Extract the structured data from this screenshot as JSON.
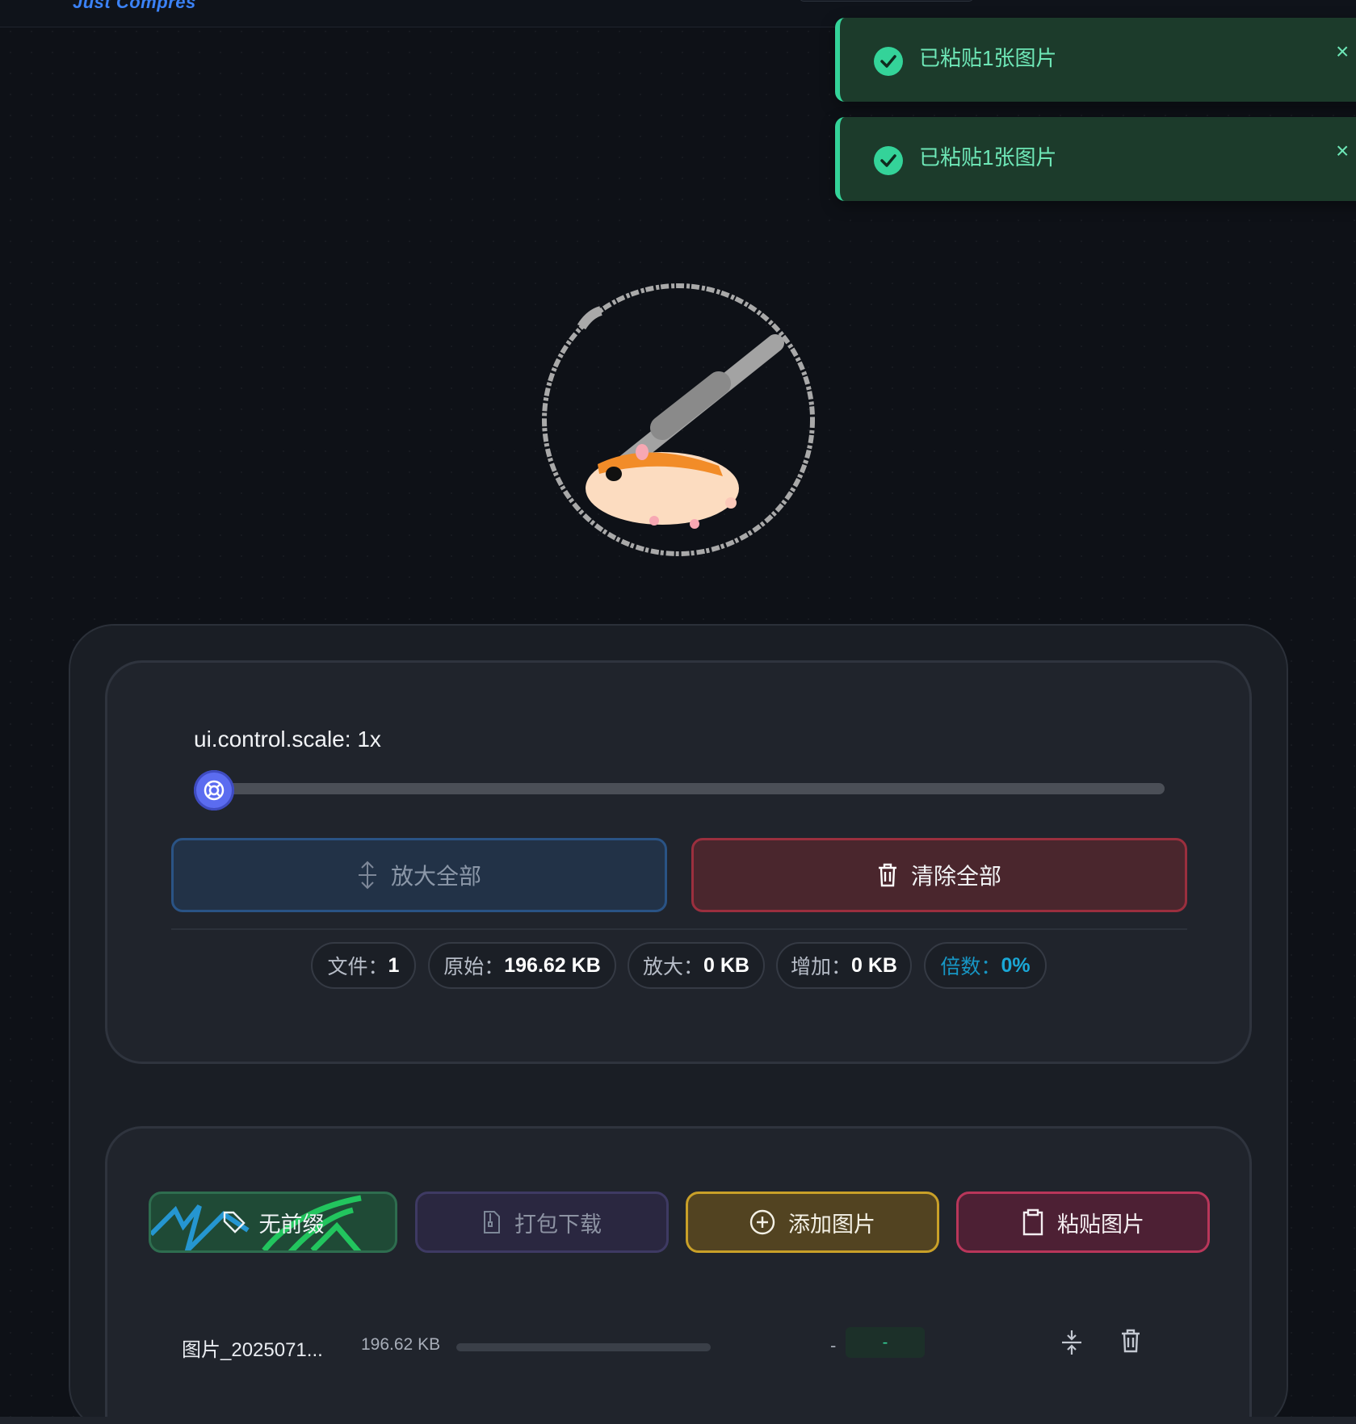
{
  "header": {
    "brand": "Just Compres"
  },
  "toasts": [
    {
      "message": "已粘贴1张图片",
      "close_label": "×"
    },
    {
      "message": "已粘贴1张图片",
      "close_label": "×"
    }
  ],
  "controls": {
    "scale_label": "ui.control.scale: 1x",
    "scale_level_percent": 0,
    "enlarge_all": "放大全部",
    "clear_all": "清除全部"
  },
  "stats": {
    "files": {
      "label": "文件：",
      "value": "1"
    },
    "original": {
      "label": "原始：",
      "value": "196.62 KB"
    },
    "enlarged": {
      "label": "放大：",
      "value": "0 KB"
    },
    "increase": {
      "label": "增加：",
      "value": "0 KB"
    },
    "rate": {
      "label": "倍数：",
      "value": "0%"
    }
  },
  "actions": {
    "prefix": "无前缀",
    "pack_download": "打包下载",
    "add_image": "添加图片",
    "paste_image": "粘贴图片"
  },
  "files": [
    {
      "name": "图片_2025071...",
      "size": "196.62 KB",
      "result": "-",
      "ratio": "-",
      "progress_percent": 0
    }
  ],
  "colors": {
    "accent": "#5b6cf0",
    "success": "#34d399",
    "danger": "#9b2f3e",
    "warning": "#c9a028"
  }
}
